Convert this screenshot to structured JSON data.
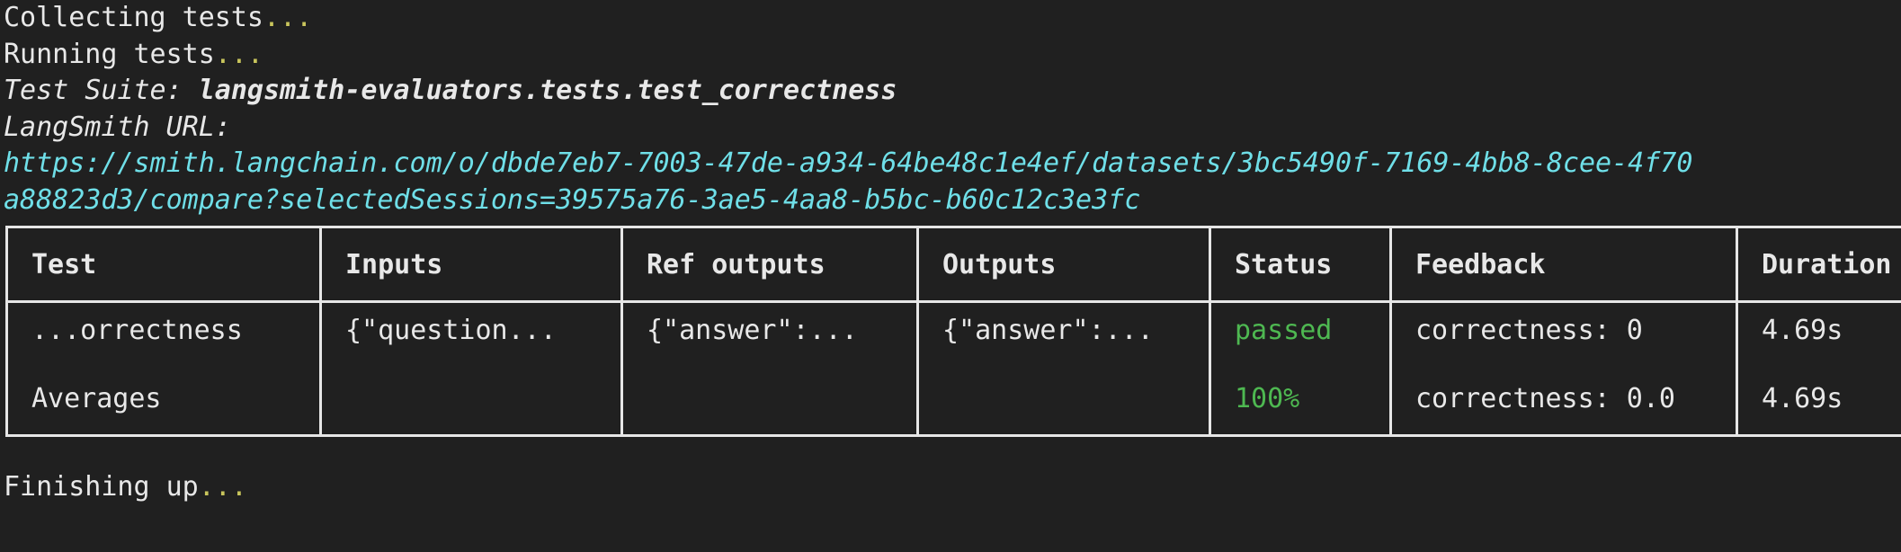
{
  "terminal": {
    "background_color": "#202020",
    "text_color": "#e8e8e8",
    "ellipsis_color": "#c9c55c",
    "url_color": "#6fdfe8",
    "status_color": "#4eb851",
    "lines": {
      "collecting": "Collecting tests",
      "collecting_dots": "...",
      "running": "Running tests",
      "running_dots": "...",
      "test_suite_label": "Test Suite: ",
      "test_suite_name": "langsmith-evaluators.tests.test_correctness",
      "langsmith_url_label": "LangSmith URL:",
      "url_line_1": "https://smith.langchain.com/o/dbde7eb7-7003-47de-a934-64be48c1e4ef/datasets/3bc5490f-7169-4bb8-8cee-4f70",
      "url_line_2": "a88823d3/compare?selectedSessions=39575a76-3ae5-4aa8-b5bc-b60c12c3e3fc",
      "finishing": "Finishing up",
      "finishing_dots": "..."
    }
  },
  "table": {
    "headers": {
      "test": "Test",
      "inputs": "Inputs",
      "ref_outputs": "Ref outputs",
      "outputs": "Outputs",
      "status": "Status",
      "feedback": "Feedback",
      "duration": "Duration"
    },
    "rows": [
      {
        "test": "...orrectness",
        "inputs": "{\"question...",
        "ref_outputs": "{\"answer\":...",
        "outputs": "{\"answer\":...",
        "status": "passed",
        "feedback": "correctness: 0",
        "duration": "4.69s"
      },
      {
        "test": "Averages",
        "inputs": "",
        "ref_outputs": "",
        "outputs": "",
        "status": "100%",
        "feedback": "correctness: 0.0",
        "duration": "4.69s"
      }
    ]
  }
}
